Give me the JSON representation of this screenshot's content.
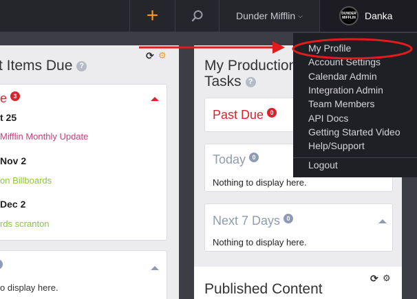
{
  "topbar": {
    "add_icon": "plus-icon",
    "search_icon": "search-icon",
    "org_name": "Dunder Mifflin",
    "org_chevron": "⌵",
    "user_name": "Danka",
    "logo_text_1": "DUNDER",
    "logo_text_2": "MIFFLIN"
  },
  "left_panel": {
    "title": "t Items Due",
    "past_due": {
      "label": "e",
      "count": "3"
    },
    "items": [
      {
        "date": "t 25",
        "name": "Mifflin Monthly Update"
      },
      {
        "date": "Nov 2",
        "name": "on Billboards"
      },
      {
        "date": "Dec 2",
        "name": "rds scranton"
      }
    ],
    "bottom_text": "o display here."
  },
  "mid_panel": {
    "title_line1": "My Production",
    "title_line2": "Tasks",
    "past_due": {
      "label": "Past Due",
      "count": "0"
    },
    "today": {
      "label": "Today",
      "count": "0",
      "empty": "Nothing to display here."
    },
    "next7": {
      "label": "Next 7 Days",
      "count": "0",
      "empty": "Nothing to display here."
    },
    "published": "Published Content"
  },
  "dropdown": {
    "items": [
      "My Profile",
      "Account Settings",
      "Calendar Admin",
      "Integration Admin",
      "Team Members",
      "API Docs",
      "Getting Started Video",
      "Help/Support"
    ],
    "logout": "Logout"
  },
  "colors": {
    "accent": "#f39c1f",
    "danger": "#d9232d",
    "magenta_link": "#c0417e",
    "green_link": "#8cc63f",
    "annotation": "#e31b1b"
  }
}
